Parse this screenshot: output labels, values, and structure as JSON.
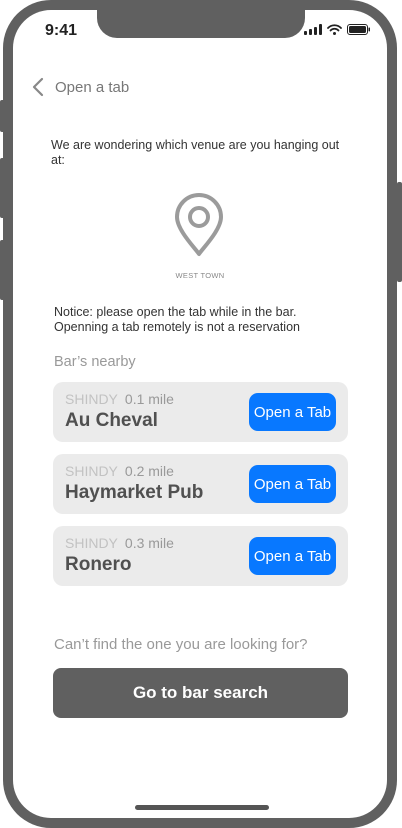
{
  "status_bar": {
    "time": "9:41",
    "icons": [
      "signal-icon",
      "wifi-icon",
      "battery-icon"
    ]
  },
  "nav": {
    "back_icon": "chevron-left-icon",
    "title": "Open a tab"
  },
  "intro_text": "We are wondering which venue are you hanging out at:",
  "location": {
    "icon": "map-pin-icon",
    "label": "WEST TOWN"
  },
  "notice_text": "Notice: please open the tab while in the bar. Openning a tab remotely is not a reservation",
  "nearby": {
    "heading": "Bar’s nearby",
    "bars": [
      {
        "tag": "SHINDY",
        "distance": "0.1 mile",
        "name": "Au Cheval",
        "button": "Open a Tab"
      },
      {
        "tag": "SHINDY",
        "distance": "0.2 mile",
        "name": "Haymarket Pub",
        "button": "Open a Tab"
      },
      {
        "tag": "SHINDY",
        "distance": "0.3 mile",
        "name": "Ronero",
        "button": "Open a Tab"
      }
    ]
  },
  "footer": {
    "prompt": "Can’t find the one you are looking for?",
    "search_button": "Go to bar search"
  },
  "colors": {
    "accent": "#0878ff",
    "frame": "#606060",
    "card": "#ebebeb"
  }
}
